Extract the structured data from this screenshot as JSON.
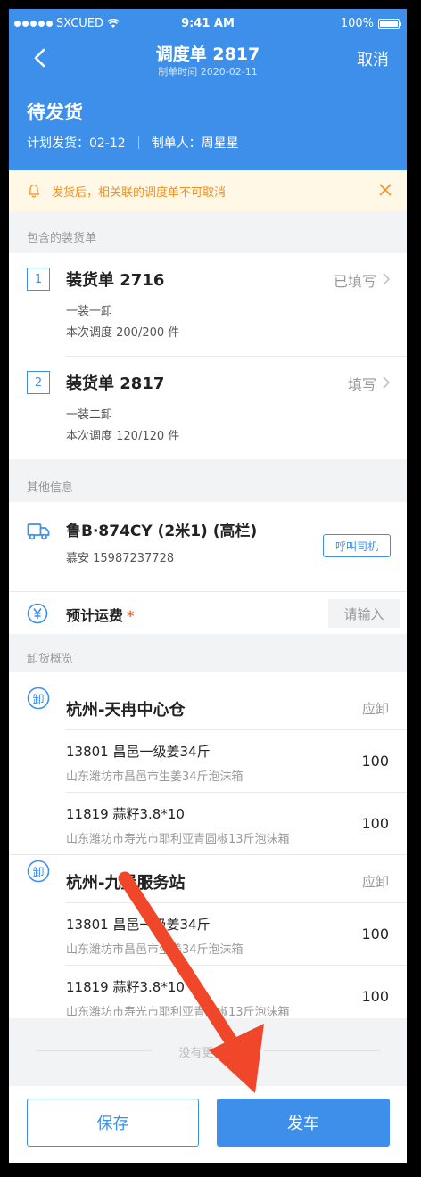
{
  "status_bar": {
    "carrier": "SXCUED",
    "time": "9:41 AM",
    "battery": "100%"
  },
  "header": {
    "title": "调度单 2817",
    "subtitle": "制单时间 2020-02-11",
    "cancel_label": "取消",
    "status": "待发货",
    "plan_date": "计划发货：02-12",
    "creator": "制单人：周星星"
  },
  "notice": {
    "text": "发货后，相关联的调度单不可取消"
  },
  "sections": {
    "loading": "包含的装货单",
    "other": "其他信息",
    "unloading": "卸货概览"
  },
  "loading_orders": [
    {
      "index": "1",
      "title": "装货单 2716",
      "mode": "一装一卸",
      "amount": "本次调度 200/200 件",
      "status": "已填写"
    },
    {
      "index": "2",
      "title": "装货单 2817",
      "mode": "一装二卸",
      "amount": "本次调度 120/120 件",
      "status": "填写"
    }
  ],
  "vehicle": {
    "plate": "鲁B·874CY (2米1) (高栏)",
    "driver": "慕安 15987237728",
    "call_label": "呼叫司机"
  },
  "freight": {
    "label": "预计运费",
    "required_mark": "*",
    "placeholder": "请输入"
  },
  "destinations": [
    {
      "icon_char": "卸",
      "name": "杭州-天冉中心仓",
      "tag": "应卸",
      "goods": [
        {
          "name": "13801  昌邑一级姜34斤",
          "desc": "山东潍坊市昌邑市生姜34斤泡沫箱",
          "qty": "100"
        },
        {
          "name": "11819  蒜籽3.8*10",
          "desc": "山东潍坊市寿光市耶利亚青圆椒13斤泡沫箱",
          "qty": "100"
        }
      ]
    },
    {
      "icon_char": "卸",
      "name": "杭州-九堡服务站",
      "tag": "应卸",
      "goods": [
        {
          "name": "13801  昌邑一级姜34斤",
          "desc": "山东潍坊市昌邑市生姜34斤泡沫箱",
          "qty": "100"
        },
        {
          "name": "11819  蒜籽3.8*10",
          "desc": "山东潍坊市寿光市耶利亚青圆椒13斤泡沫箱",
          "qty": "100"
        }
      ]
    }
  ],
  "no_more": "没有更多了",
  "actions": {
    "save": "保存",
    "depart": "发车"
  },
  "colors": {
    "primary": "#3e8fe9",
    "warning": "#f29025",
    "annotation_arrow": "#f0462a"
  }
}
